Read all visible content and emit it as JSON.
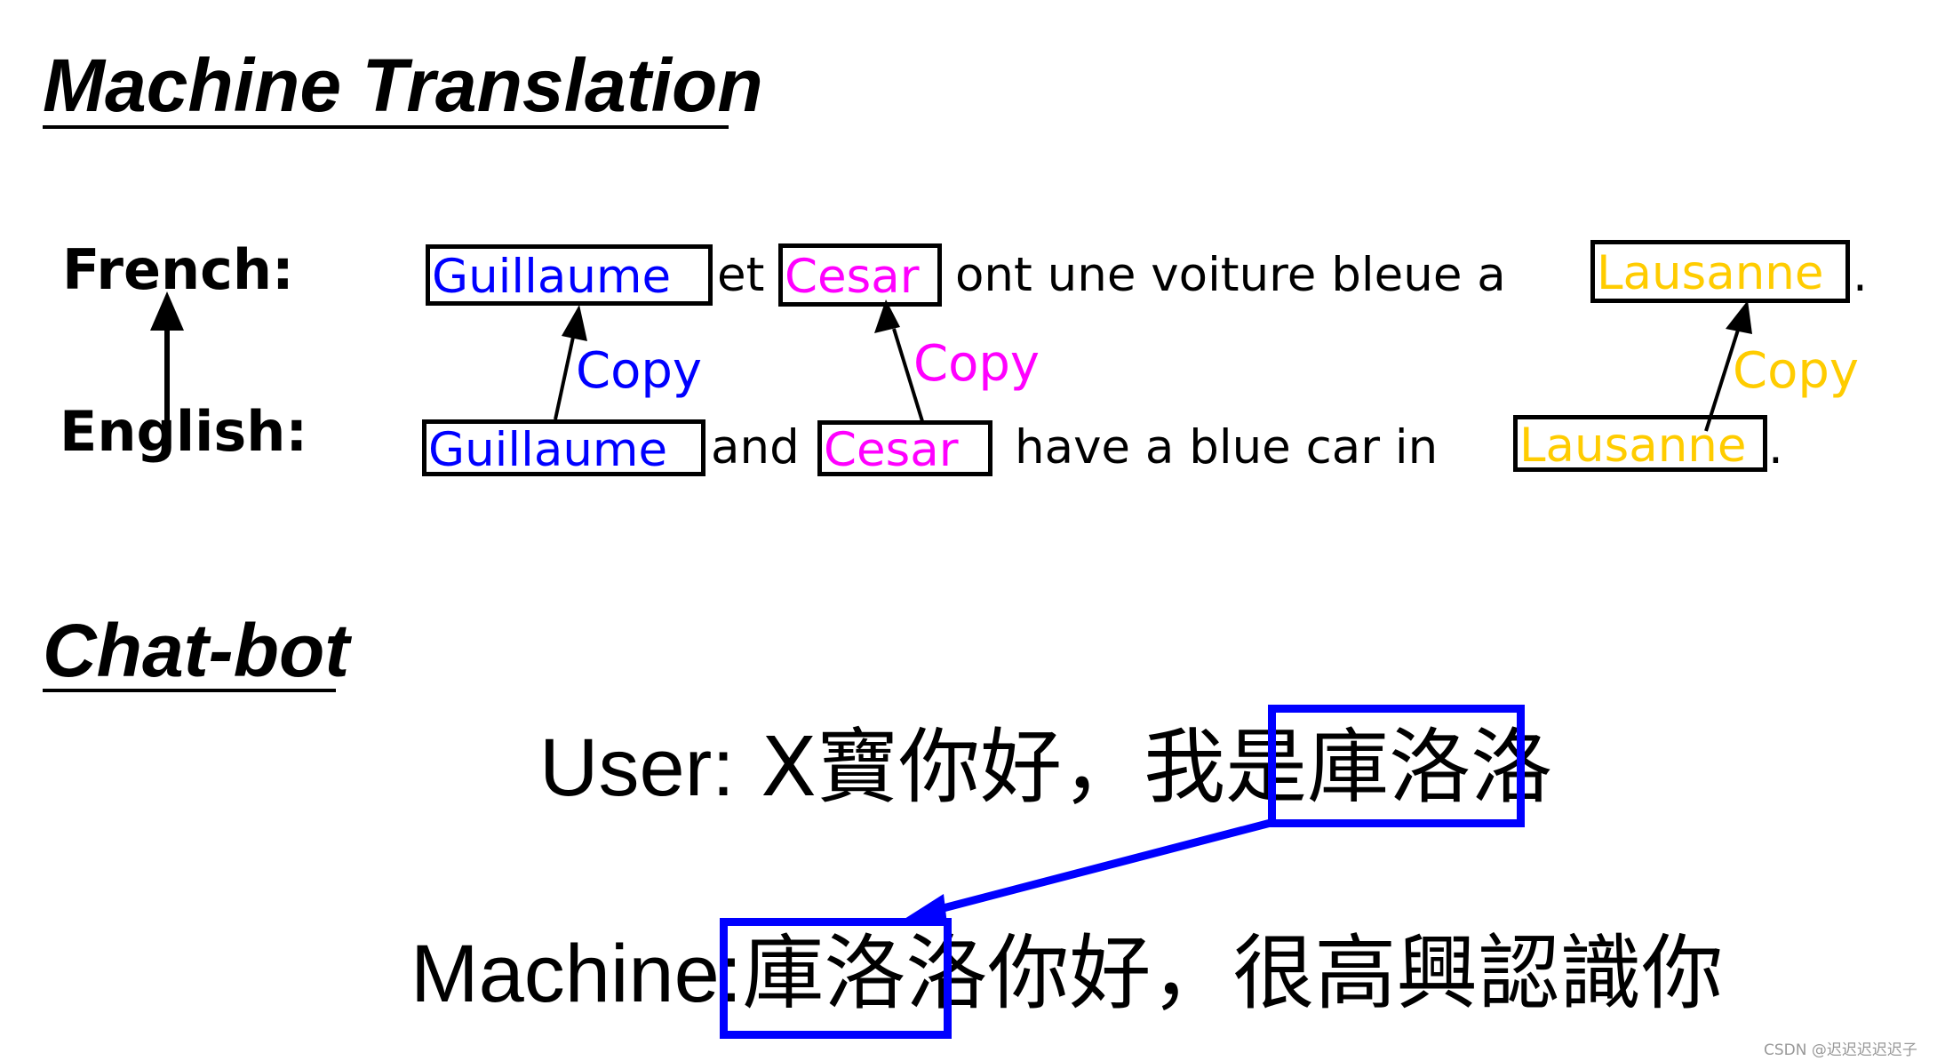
{
  "colors": {
    "name1": "#0000ff",
    "name2": "#ff00ff",
    "name3": "#ffcc00",
    "chatbot_highlight": "#0000ff",
    "text": "#000000"
  },
  "machine_translation": {
    "title": "Machine Translation",
    "french_label": "French:",
    "english_label": "English:",
    "french_sentence": {
      "name1": "Guillaume",
      "conj": "et",
      "name2": "Cesar",
      "middle": "ont une voiture bleue a",
      "name3": "Lausanne",
      "end": "."
    },
    "english_sentence": {
      "name1": "Guillaume",
      "conj": "and",
      "name2": "Cesar",
      "middle": "have a blue car in",
      "name3": "Lausanne",
      "end": "."
    },
    "copy_labels": [
      "Copy",
      "Copy",
      "Copy"
    ]
  },
  "chatbot": {
    "title": "Chat-bot",
    "user_prefix": "User:",
    "user_text_before": "X寶你好，我是",
    "user_copied": "庫洛洛",
    "machine_prefix": "Machine:",
    "machine_copied": "庫洛洛",
    "machine_text_after": "你好，很高興認識你"
  },
  "watermark": "CSDN @迟迟迟迟迟子"
}
